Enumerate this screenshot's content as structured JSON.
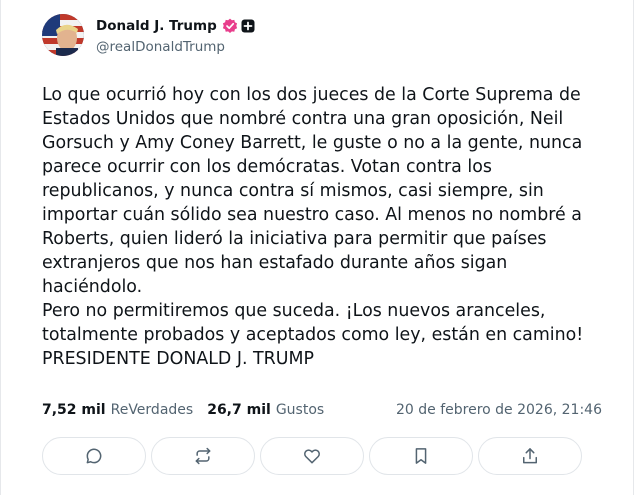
{
  "author": {
    "name": "Donald J. Trump",
    "handle": "@realDonaldTrump",
    "verified_badge_icon": "verified-badge-icon",
    "plus_badge_icon": "plus-badge-icon",
    "badge_color": "#e83e8c"
  },
  "post": {
    "text": "Lo que ocurrió hoy con los dos jueces de la Corte Suprema de\nEstados Unidos que nombré contra una gran oposición, Neil\nGorsuch y Amy Coney Barrett, le guste o no a la gente, nunca\nparece ocurrir con los demócratas. Votan contra los\nrepublicanos, y nunca contra sí mismos, casi siempre, sin\nimportar cuán sólido sea nuestro caso. Al menos no nombré a\nRoberts, quien lideró la iniciativa para permitir que países\nextranjeros que nos han estafado durante años sigan haciéndolo.\nPero no permitiremos que suceda. ¡Los nuevos aranceles,\ntotalmente probados y aceptados como ley, están en camino!\nPRESIDENTE DONALD J. TRUMP"
  },
  "stats": {
    "reposts_count": "7,52 mil",
    "reposts_label": "ReVerdades",
    "likes_count": "26,7 mil",
    "likes_label": "Gustos",
    "date": "20 de febrero de 2026, 21:46"
  },
  "actions": [
    {
      "icon": "reply-icon"
    },
    {
      "icon": "repost-icon"
    },
    {
      "icon": "heart-icon"
    },
    {
      "icon": "bookmark-icon"
    },
    {
      "icon": "share-icon"
    }
  ]
}
